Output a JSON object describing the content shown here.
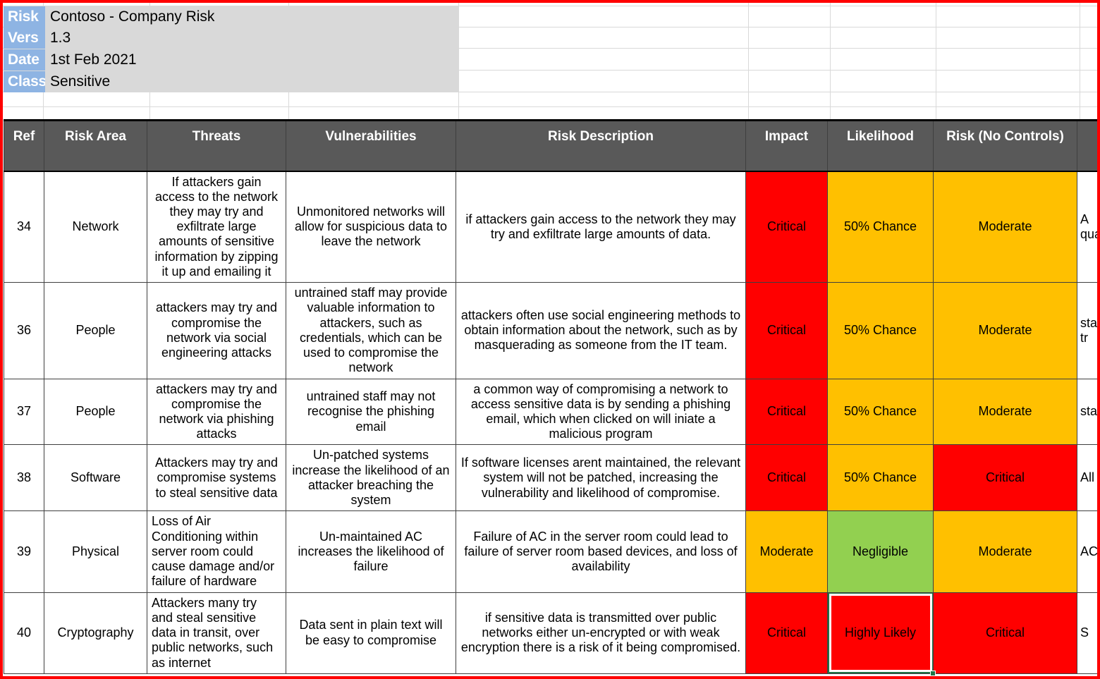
{
  "document": {
    "meta": [
      {
        "label": "Risk",
        "value": "Contoso - Company Risk"
      },
      {
        "label": "Vers",
        "value": "1.3"
      },
      {
        "label": "Date",
        "value": "1st Feb 2021"
      },
      {
        "label": "Class",
        "value": "Sensitive"
      }
    ]
  },
  "table": {
    "headers": [
      "Ref",
      "Risk Area",
      "Threats",
      "Vulnerabilities",
      "Risk Description",
      "Impact",
      "Likelihood",
      "Risk (No Controls)",
      ""
    ],
    "rows": [
      {
        "ref": "34",
        "risk_area": "Network",
        "threats": "If attackers gain access to the network they may try and exfiltrate large amounts of sensitive information by zipping it up and emailing it",
        "threats_align": "center",
        "vulnerabilities": "Unmonitored networks will allow for suspicious data to leave the network",
        "risk_description": "if attackers gain access to the network they may try and exfiltrate large amounts of data.",
        "impact": "Critical",
        "impact_color": "sev-critical",
        "likelihood": "50% Chance",
        "likelihood_color": "sev-moderate",
        "risk_no_controls": "Moderate",
        "risk_color": "sev-moderate",
        "extra": "A qua",
        "selected": false
      },
      {
        "ref": "36",
        "risk_area": "People",
        "threats": "attackers may try and compromise the network via social engineering attacks",
        "threats_align": "center",
        "vulnerabilities": "untrained staff may provide valuable information to attackers, such as credentials, which can be used to compromise the network",
        "risk_description": "attackers often use social engineering methods to obtain information about the network, such as by masquerading as someone from the IT team.",
        "impact": "Critical",
        "impact_color": "sev-critical",
        "likelihood": "50% Chance",
        "likelihood_color": "sev-moderate",
        "risk_no_controls": "Moderate",
        "risk_color": "sev-moderate",
        "extra": "sta tr",
        "selected": false
      },
      {
        "ref": "37",
        "risk_area": "People",
        "threats": "attackers may try and compromise the network via phishing attacks",
        "threats_align": "center",
        "vulnerabilities": "untrained staff may not recognise the phishing email",
        "risk_description": "a common way of compromising a network to access sensitive data is by sending a phishing email, which when clicked on will iniate a malicious program",
        "impact": "Critical",
        "impact_color": "sev-critical",
        "likelihood": "50% Chance",
        "likelihood_color": "sev-moderate",
        "risk_no_controls": "Moderate",
        "risk_color": "sev-moderate",
        "extra": "sta",
        "selected": false
      },
      {
        "ref": "38",
        "risk_area": "Software",
        "threats": "Attackers may try and compromise systems to steal sensitive data",
        "threats_align": "center",
        "vulnerabilities": "Un-patched systems increase the likelihood of an attacker breaching the system",
        "risk_description": "If software licenses arent maintained, the relevant system will not be patched, increasing the vulnerability and likelihood of compromise.",
        "impact": "Critical",
        "impact_color": "sev-critical",
        "likelihood": "50% Chance",
        "likelihood_color": "sev-moderate",
        "risk_no_controls": "Critical",
        "risk_color": "sev-critical",
        "extra": "All",
        "selected": false
      },
      {
        "ref": "39",
        "risk_area": "Physical",
        "threats": "Loss of Air Conditioning within server room could cause damage and/or failure of hardware",
        "threats_align": "left",
        "vulnerabilities": "Un-maintained AC increases the likelihood of failure",
        "risk_description": "Failure of AC in the server room could lead to failure of server room based devices, and loss of availability",
        "impact": "Moderate",
        "impact_color": "sev-moderate",
        "likelihood": "Negligible",
        "likelihood_color": "sev-negligible",
        "risk_no_controls": "Moderate",
        "risk_color": "sev-moderate",
        "extra": "AC",
        "selected": false
      },
      {
        "ref": "40",
        "risk_area": "Cryptography",
        "threats": "Attackers many try and steal sensitive data in transit, over public networks, such as internet",
        "threats_align": "left",
        "vulnerabilities": "Data sent in plain text will be easy to compromise",
        "risk_description": "if sensitive data is transmitted over public networks either un-encrypted or with weak encryption there is a risk of it being compromised.",
        "impact": "Critical",
        "impact_color": "sev-critical",
        "likelihood": "Highly Likely",
        "likelihood_color": "sev-critical",
        "risk_no_controls": "Critical",
        "risk_color": "sev-critical",
        "extra": "S",
        "selected": true
      }
    ]
  },
  "colors": {
    "critical": "#FF0000",
    "moderate": "#FFC000",
    "negligible": "#92D050",
    "header_bg": "#595959",
    "meta_label_bg": "#8EB4E3",
    "meta_block_bg": "#D9D9D9",
    "selection_border": "#217346",
    "outer_border": "#FF0000"
  }
}
